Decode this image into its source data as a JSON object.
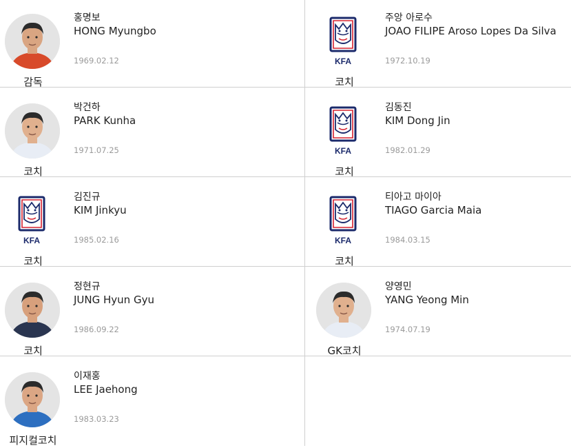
{
  "colors": {
    "divider": "#cfcfcf",
    "text": "#222222",
    "date": "#9a9a9a",
    "kfa_blue": "#1b2a6b",
    "kfa_red": "#d6202e"
  },
  "staff": [
    {
      "korean": "홍명보",
      "english": "HONG Myungbo",
      "dob": "1969.02.12",
      "role": "감독",
      "image": "photo",
      "icon": "portrait-photo"
    },
    {
      "korean": "주앙 아로수",
      "english": "JOAO FILIPE Aroso Lopes Da Silva",
      "dob": "1972.10.19",
      "role": "코치",
      "image": "kfa",
      "emblem_text": "KFA",
      "icon": "kfa-emblem-icon"
    },
    {
      "korean": "박건하",
      "english": "PARK Kunha",
      "dob": "1971.07.25",
      "role": "코치",
      "image": "photo",
      "icon": "portrait-photo"
    },
    {
      "korean": "김동진",
      "english": "KIM Dong Jin",
      "dob": "1982.01.29",
      "role": "코치",
      "image": "kfa",
      "emblem_text": "KFA",
      "icon": "kfa-emblem-icon"
    },
    {
      "korean": "김진규",
      "english": "KIM Jinkyu",
      "dob": "1985.02.16",
      "role": "코치",
      "image": "kfa",
      "emblem_text": "KFA",
      "icon": "kfa-emblem-icon"
    },
    {
      "korean": "티아고 마이아",
      "english": "TIAGO Garcia Maia",
      "dob": "1984.03.15",
      "role": "코치",
      "image": "kfa",
      "emblem_text": "KFA",
      "icon": "kfa-emblem-icon"
    },
    {
      "korean": "정현규",
      "english": "JUNG Hyun Gyu",
      "dob": "1986.09.22",
      "role": "코치",
      "image": "photo",
      "icon": "portrait-photo"
    },
    {
      "korean": "양영민",
      "english": "YANG Yeong Min",
      "dob": "1974.07.19",
      "role": "GK코치",
      "image": "photo",
      "icon": "portrait-photo"
    },
    {
      "korean": "이재홍",
      "english": "LEE Jaehong",
      "dob": "1983.03.23",
      "role": "피지컬코치",
      "image": "photo",
      "icon": "portrait-photo"
    }
  ]
}
